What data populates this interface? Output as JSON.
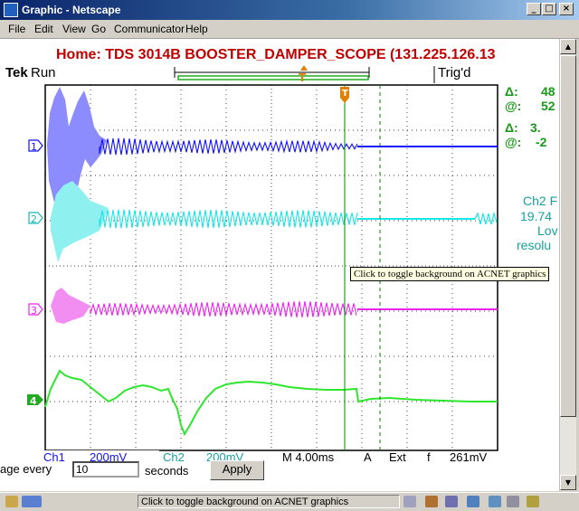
{
  "window": {
    "title": "Graphic - Netscape",
    "min_glyph": "_",
    "max_glyph": "□",
    "close_glyph": "×"
  },
  "menu": [
    "File",
    "Edit",
    "View",
    "Go",
    "Communicator",
    "Help"
  ],
  "page": {
    "heading": "Home:  TDS 3014B  BOOSTER_DAMPER_SCOPE  (131.225.126.13",
    "refresh_label": "age every",
    "refresh_value": "10",
    "refresh_unit": "seconds",
    "apply_label": "Apply"
  },
  "scope": {
    "brand": "Tek",
    "run_state": "Run",
    "trig_state": "Trig'd",
    "trigger_marker": "T",
    "channel_labels": [
      "1",
      "2",
      "3",
      "4"
    ],
    "readouts": {
      "delta1": "Δ:",
      "delta1_val": "48",
      "at1": "@:",
      "at1_val": "52",
      "delta2": "Δ:",
      "delta2_val": "3.",
      "at2": "@:",
      "at2_val": "-2"
    },
    "side_info": [
      "Ch2 F",
      "19.74",
      "Lov",
      "resolu"
    ],
    "bottom": {
      "ch1": "Ch1",
      "ch1_val": "200mV",
      "ch2": "Ch2",
      "ch2_val": "200mV",
      "time": "M 4.00ms",
      "a": "A",
      "ext": "Ext",
      "slope": "f",
      "trig_level": "261mV"
    },
    "colors": {
      "ch1": "#1010ff",
      "ch1_fill": "#8c8cff",
      "ch2": "#19e6e6",
      "ch3": "#ee22ee",
      "ch4": "#2ee62e",
      "grid": "#000000",
      "cursor": "#008800",
      "trigger": "#e08000"
    }
  },
  "tooltip": "Click to toggle background on ACNET graphics",
  "status": {
    "text": "Click to toggle background on ACNET graphics",
    "icons": [
      "lock-icon",
      "network-icon",
      "component-icon",
      "mail-icon",
      "bookmark-icon",
      "print-icon",
      "chat-icon",
      "edit-icon"
    ]
  }
}
